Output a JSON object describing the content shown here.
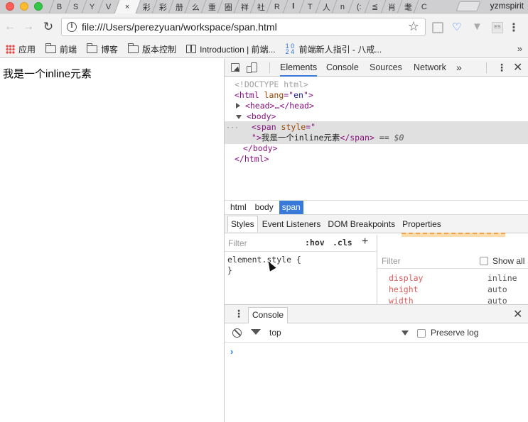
{
  "browser": {
    "tabs": [
      "B",
      "S",
      "Y",
      "V",
      "×",
      "彩",
      "彩",
      "册",
      "么",
      "重",
      "圈",
      "祥",
      "社",
      "R",
      "𝐈",
      "T",
      "人",
      "n",
      "(:",
      "≦",
      "肖",
      "耄",
      "C"
    ],
    "profile_name": "yzmspirit",
    "url": "file:///Users/perezyuan/workspace/span.html",
    "extension_es_label": "ES",
    "bookmarks": [
      {
        "label": "应用",
        "icon": "apps-icon"
      },
      {
        "label": "前端",
        "icon": "folder-icon"
      },
      {
        "label": "博客",
        "icon": "folder-icon"
      },
      {
        "label": "版本控制",
        "icon": "folder-icon"
      },
      {
        "label": "Introduction | 前端...",
        "icon": "book-icon"
      },
      {
        "label": "前端新人指引 - 八戒...",
        "icon": "number-icon"
      }
    ],
    "bookmarks_more": "»"
  },
  "page": {
    "span_text": "我是一个inline元素"
  },
  "devtools": {
    "tabs": {
      "elements": "Elements",
      "console": "Console",
      "sources": "Sources",
      "network": "Network",
      "more": "»"
    },
    "dom": {
      "doctype": "<!DOCTYPE html>",
      "html_open_tag": "<html",
      "html_lang_attr": " lang",
      "html_lang_eq": "=\"",
      "html_lang_val": "en",
      "html_lang_close": "\">",
      "head_collapsed": "<head>…</head>",
      "body_open": "<body>",
      "span_open": "<span",
      "span_style_attr": " style",
      "span_style_eq": "=\"",
      "span_line2_prefix": "\">",
      "span_text": "我是一个inline元素",
      "span_close": "</span>",
      "selected_marker": " == $0",
      "body_close": "</body>",
      "html_close": "</html>",
      "ellipsis": "···"
    },
    "breadcrumb": [
      "html",
      "body",
      "span"
    ],
    "styles_tabs": [
      "Styles",
      "Event Listeners",
      "DOM Breakpoints",
      "Properties"
    ],
    "styles": {
      "filter_placeholder": "Filter",
      "hov": ":hov",
      "cls": ".cls",
      "add": "+",
      "rule_selector": "element.style {",
      "rule_close": "}"
    },
    "computed": {
      "filter_placeholder": "Filter",
      "show_all_label": "Show all",
      "properties": [
        {
          "name": "display",
          "value": "inline"
        },
        {
          "name": "height",
          "value": "auto"
        },
        {
          "name": "width",
          "value": "auto"
        }
      ]
    },
    "drawer": {
      "tab_label": "Console",
      "context": "top",
      "preserve_log_label": "Preserve log",
      "prompt": "›"
    }
  }
}
